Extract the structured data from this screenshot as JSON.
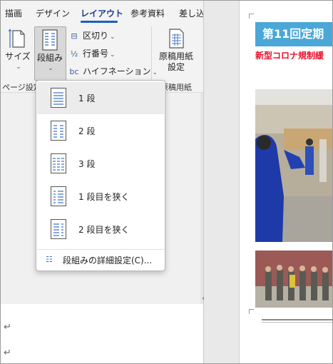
{
  "tabs": [
    {
      "label": "描画",
      "active": false
    },
    {
      "label": "デザイン",
      "active": false
    },
    {
      "label": "レイアウト",
      "active": true
    },
    {
      "label": "参考資料",
      "active": false
    },
    {
      "label": "差し込"
    }
  ],
  "ribbon": {
    "size_label": "サイズ",
    "size_chevron": "⌄",
    "dangumi_label": "段組み",
    "dangumi_chevron": "⌄",
    "breaks_label": "区切り",
    "line_numbers_label": "行番号",
    "hyphenation_label": "ハイフネーション",
    "genko_label_1": "原稿用紙",
    "genko_label_2": "設定",
    "group_page_setup": "ページ設定",
    "group_genko": "原稿用紙"
  },
  "column_menu": {
    "items": [
      {
        "label": "1 段",
        "columns": 1
      },
      {
        "label": "2 段",
        "columns": 2
      },
      {
        "label": "3 段",
        "columns": 3
      },
      {
        "label": "1 段目を狭く",
        "columns": "left"
      },
      {
        "label": "2 段目を狭く",
        "columns": "right"
      }
    ],
    "detail_label": "段組みの詳細設定(C)..."
  },
  "document": {
    "paragraph_mark": "↵",
    "title": "第11回定期",
    "subtitle": "新型コロナ規制緩"
  },
  "colors": {
    "accent": "#1f5fbf",
    "title_bar": "#4aa7d8",
    "subtitle": "#e8102a"
  }
}
